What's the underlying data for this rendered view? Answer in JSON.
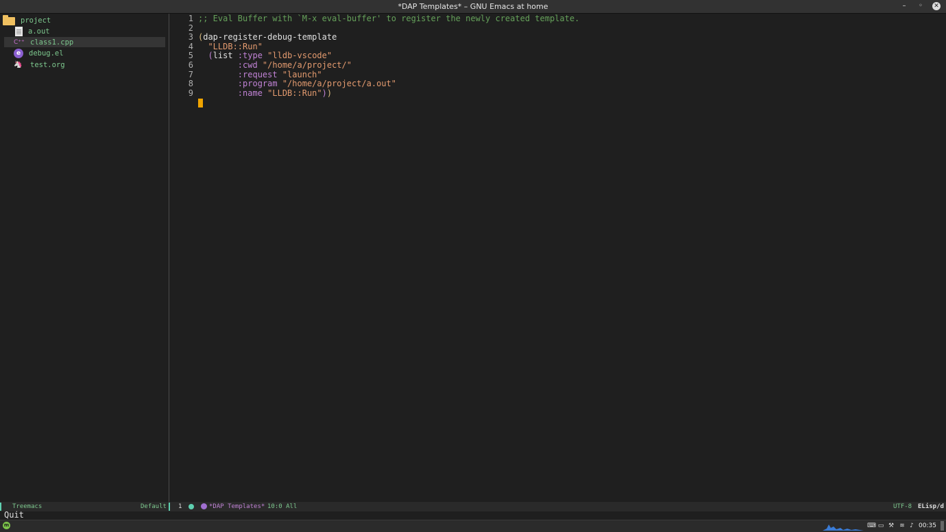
{
  "window": {
    "title": "*DAP Templates* – GNU Emacs at home",
    "minimize": "–",
    "maximize": "◦",
    "close": "✕"
  },
  "sidebar": {
    "root": "project",
    "items": [
      {
        "label": "a.out",
        "icon": "file-icon"
      },
      {
        "label": "class1.cpp",
        "icon": "cpp-file-icon"
      },
      {
        "label": "debug.el",
        "icon": "emacs-lisp-icon"
      },
      {
        "label": "test.org",
        "icon": "org-unicorn-icon"
      }
    ],
    "selected": "class1.cpp"
  },
  "editor": {
    "line_numbers": [
      "1",
      "2",
      "3",
      "4",
      "5",
      "6",
      "7",
      "8",
      "9"
    ],
    "lines": [
      {
        "n": "1",
        "parts": [
          {
            "t": ";; Eval Buffer with `M-x eval-buffer' to register the newly created template.",
            "c": "c-comment"
          }
        ]
      },
      {
        "n": "2",
        "parts": []
      },
      {
        "n": "3",
        "parts": [
          {
            "t": "(",
            "c": "c-paren2"
          },
          {
            "t": "dap-register-debug-template",
            "c": "c-plain"
          }
        ]
      },
      {
        "n": "4",
        "parts": [
          {
            "t": "  \"LLDB::Run\"",
            "c": "c-string"
          }
        ]
      },
      {
        "n": "5",
        "parts": [
          {
            "t": "  (",
            "c": "c-paren"
          },
          {
            "t": "list ",
            "c": "c-plain"
          },
          {
            "t": ":type ",
            "c": "c-keyword"
          },
          {
            "t": "\"lldb-vscode\"",
            "c": "c-string"
          }
        ]
      },
      {
        "n": "6",
        "parts": [
          {
            "t": "        :cwd ",
            "c": "c-keyword"
          },
          {
            "t": "\"/home/a/project/\"",
            "c": "c-string"
          }
        ]
      },
      {
        "n": "7",
        "parts": [
          {
            "t": "        :request ",
            "c": "c-keyword"
          },
          {
            "t": "\"launch\"",
            "c": "c-string"
          }
        ]
      },
      {
        "n": "8",
        "parts": [
          {
            "t": "        :program ",
            "c": "c-keyword"
          },
          {
            "t": "\"/home/a/project/a.out\"",
            "c": "c-string"
          }
        ]
      },
      {
        "n": "9",
        "parts": [
          {
            "t": "        :name ",
            "c": "c-keyword"
          },
          {
            "t": "\"LLDB::Run\"",
            "c": "c-string"
          },
          {
            "t": ")",
            "c": "c-paren"
          },
          {
            "t": ")",
            "c": "c-paren2"
          }
        ]
      }
    ]
  },
  "modeline": {
    "left_name": "Treemacs",
    "workspace": "Default",
    "window_number": "1",
    "buffer_name": "*DAP Templates*",
    "position": "10:0 All",
    "encoding": "UTF-8",
    "major_mode": "ELisp/d"
  },
  "echo": "Quit",
  "taskbar": {
    "menu_label": "m",
    "clock": "00:35"
  },
  "colors": {
    "background": "#1f1f1f",
    "comment": "#65a15a",
    "string": "#e49b6f",
    "keyword": "#c183d6",
    "cursor": "#f0a400",
    "treemacs_text": "#7ec98f"
  }
}
